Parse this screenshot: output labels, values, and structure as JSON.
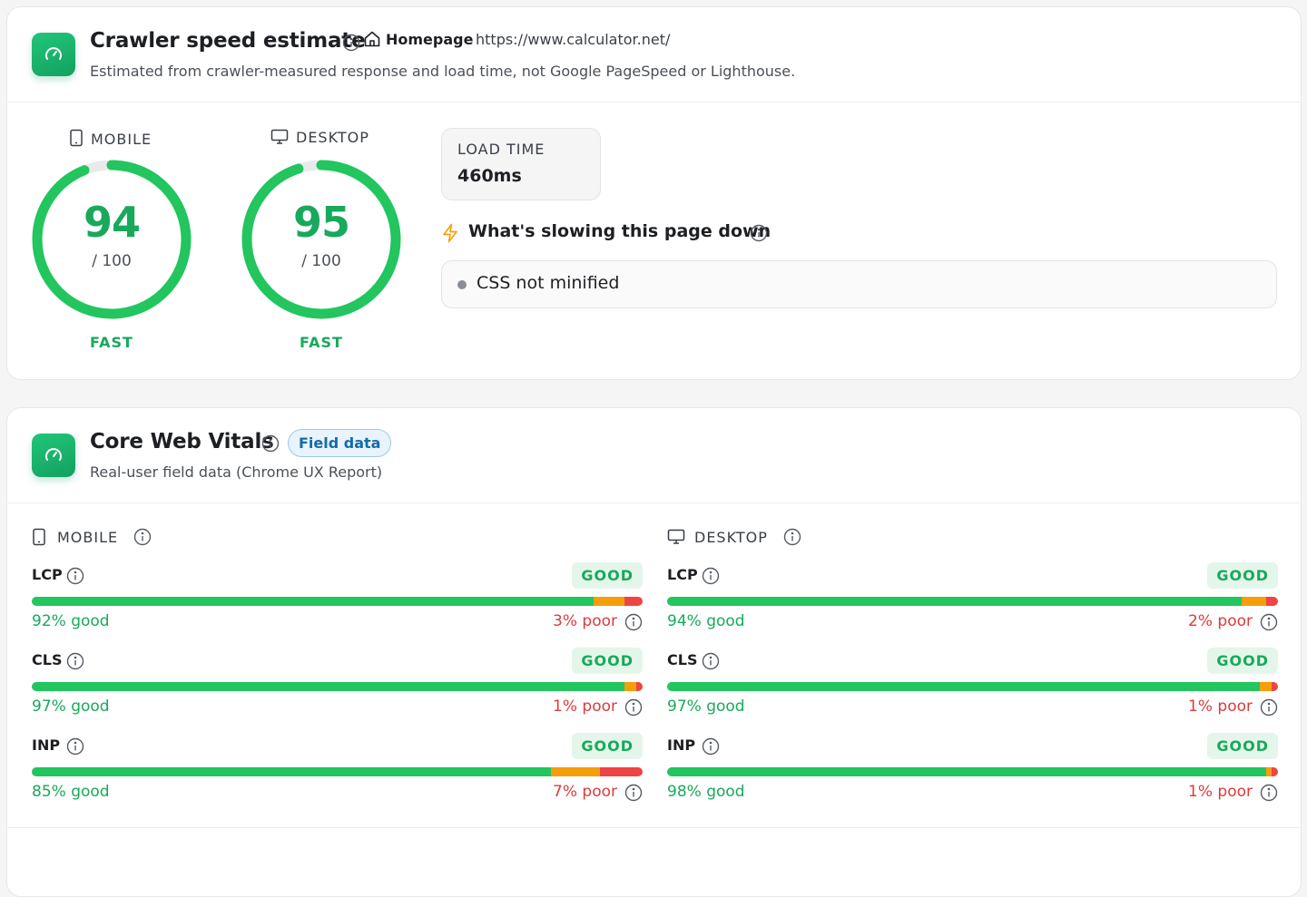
{
  "speed": {
    "title": "Crawler speed estimate",
    "homepage_label": "Homepage",
    "url": "https://www.calculator.net/",
    "subtitle": "Estimated from crawler-measured response and load time, not Google PageSpeed or Lighthouse.",
    "mobile": {
      "label": "MOBILE",
      "score": "94",
      "out_of": "/ 100",
      "rating": "FAST",
      "score_value": 94
    },
    "desktop": {
      "label": "DESKTOP",
      "score": "95",
      "out_of": "/ 100",
      "rating": "FAST",
      "score_value": 95
    },
    "load_time": {
      "label": "LOAD TIME",
      "value": "460ms"
    },
    "slowing": {
      "title": "What's slowing this page down",
      "issues": [
        "CSS not minified"
      ]
    }
  },
  "cwv": {
    "title": "Core Web Vitals",
    "badge": "Field data",
    "subtitle": "Real-user field data (Chrome UX Report)",
    "mobile": {
      "label": "MOBILE",
      "metrics": [
        {
          "name": "LCP",
          "status": "GOOD",
          "good_pct": 92,
          "poor_pct": 3,
          "good_text": "92% good",
          "poor_text": "3% poor"
        },
        {
          "name": "CLS",
          "status": "GOOD",
          "good_pct": 97,
          "poor_pct": 1,
          "good_text": "97% good",
          "poor_text": "1% poor"
        },
        {
          "name": "INP",
          "status": "GOOD",
          "good_pct": 85,
          "poor_pct": 7,
          "good_text": "85% good",
          "poor_text": "7% poor"
        }
      ]
    },
    "desktop": {
      "label": "DESKTOP",
      "metrics": [
        {
          "name": "LCP",
          "status": "GOOD",
          "good_pct": 94,
          "poor_pct": 2,
          "good_text": "94% good",
          "poor_text": "2% poor"
        },
        {
          "name": "CLS",
          "status": "GOOD",
          "good_pct": 97,
          "poor_pct": 1,
          "good_text": "97% good",
          "poor_text": "1% poor"
        },
        {
          "name": "INP",
          "status": "GOOD",
          "good_pct": 98,
          "poor_pct": 1,
          "good_text": "98% good",
          "poor_text": "1% poor"
        }
      ]
    }
  },
  "colors": {
    "good": "#22c55e",
    "needs_improvement": "#f59e0b",
    "poor": "#ef4444",
    "accent": "#18a95c"
  },
  "icons": [
    "gauge-icon",
    "info-icon",
    "home-icon",
    "mobile-icon",
    "desktop-icon",
    "lightning-icon"
  ]
}
